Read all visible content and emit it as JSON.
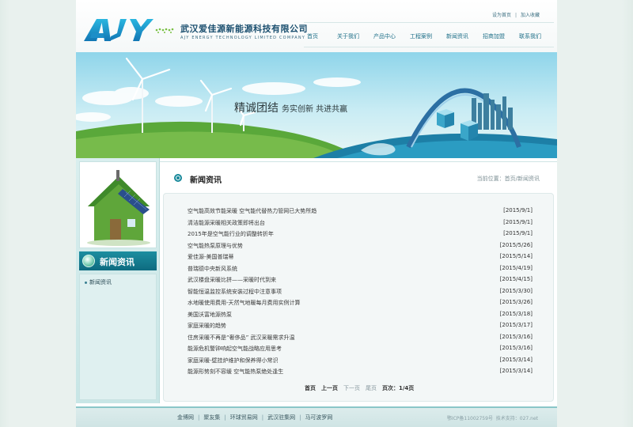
{
  "header": {
    "company_cn": "武汉爱佳源新能源科技有限公司",
    "company_en": "AJY ENERGY TECHNOLOGY LIMITED COMPANY",
    "logo_letters": "AJY",
    "toplinks": {
      "home": "设为首页",
      "fav": "加入收藏"
    }
  },
  "nav": [
    "首页",
    "关于我们",
    "产品中心",
    "工程案例",
    "新闻资讯",
    "招商加盟",
    "联系我们"
  ],
  "banner": {
    "slogan_main": "精诚团结",
    "slogan_sub": "务实创新 共进共赢"
  },
  "sidebar": {
    "title": "新闻资讯",
    "items": [
      "新闻资讯"
    ]
  },
  "content": {
    "title": "新闻资讯",
    "breadcrumb": {
      "prefix": "当前位置：",
      "home": "首页",
      "sep": "/",
      "current": "新闻资讯"
    }
  },
  "news": [
    {
      "title": "空气能高效节能采暖 空气能代替热力管网已大势所趋",
      "date": "[2015/9/1]"
    },
    {
      "title": "清洁能源采暖相关政策即将出台",
      "date": "[2015/9/1]"
    },
    {
      "title": "2015年是空气能行业的调整转折年",
      "date": "[2015/9/1]"
    },
    {
      "title": "空气能热泵原理与优势",
      "date": "[2015/5/26]"
    },
    {
      "title": "爱佳源-美国普瑞蒂",
      "date": "[2015/5/14]"
    },
    {
      "title": "普瑞德中央新风系统",
      "date": "[2015/4/19]"
    },
    {
      "title": "武汉楼盘采暖比拼——采暖时代到来",
      "date": "[2015/4/15]"
    },
    {
      "title": "智能恒温监控系统安装过程中注意事项",
      "date": "[2015/3/30]"
    },
    {
      "title": "水地暖使用费用-天然气地暖每月费用实例计算",
      "date": "[2015/3/26]"
    },
    {
      "title": "美国沃富地源热泵",
      "date": "[2015/3/18]"
    },
    {
      "title": "家庭采暖的趋势",
      "date": "[2015/3/17]"
    },
    {
      "title": "住房采暖不再是“奢侈品” 武汉采暖需求升温",
      "date": "[2015/3/16]"
    },
    {
      "title": "能源危机警钟响起空气能战略应用思考",
      "date": "[2015/3/16]"
    },
    {
      "title": "家庭采暖-壁挂炉维护和保养得小常识",
      "date": "[2015/3/14]"
    },
    {
      "title": "能源形势刻不容缓 空气能热泵绝处逢生",
      "date": "[2015/3/14]"
    }
  ],
  "pager": {
    "first": "首页",
    "prev": "上一页",
    "next": "下一页",
    "last": "尾页",
    "info": "页次：1/4页"
  },
  "footer": {
    "links": [
      "金博网",
      "聚友集",
      "环球贸易网",
      "武汉驻集网",
      "马可波罗网"
    ],
    "icp": "鄂ICP备11002759号",
    "support": "技术支持：027.net"
  },
  "colors": {
    "accent": "#17889a",
    "nav": "#1e6f88",
    "footer_border": "#8ac6c8"
  }
}
